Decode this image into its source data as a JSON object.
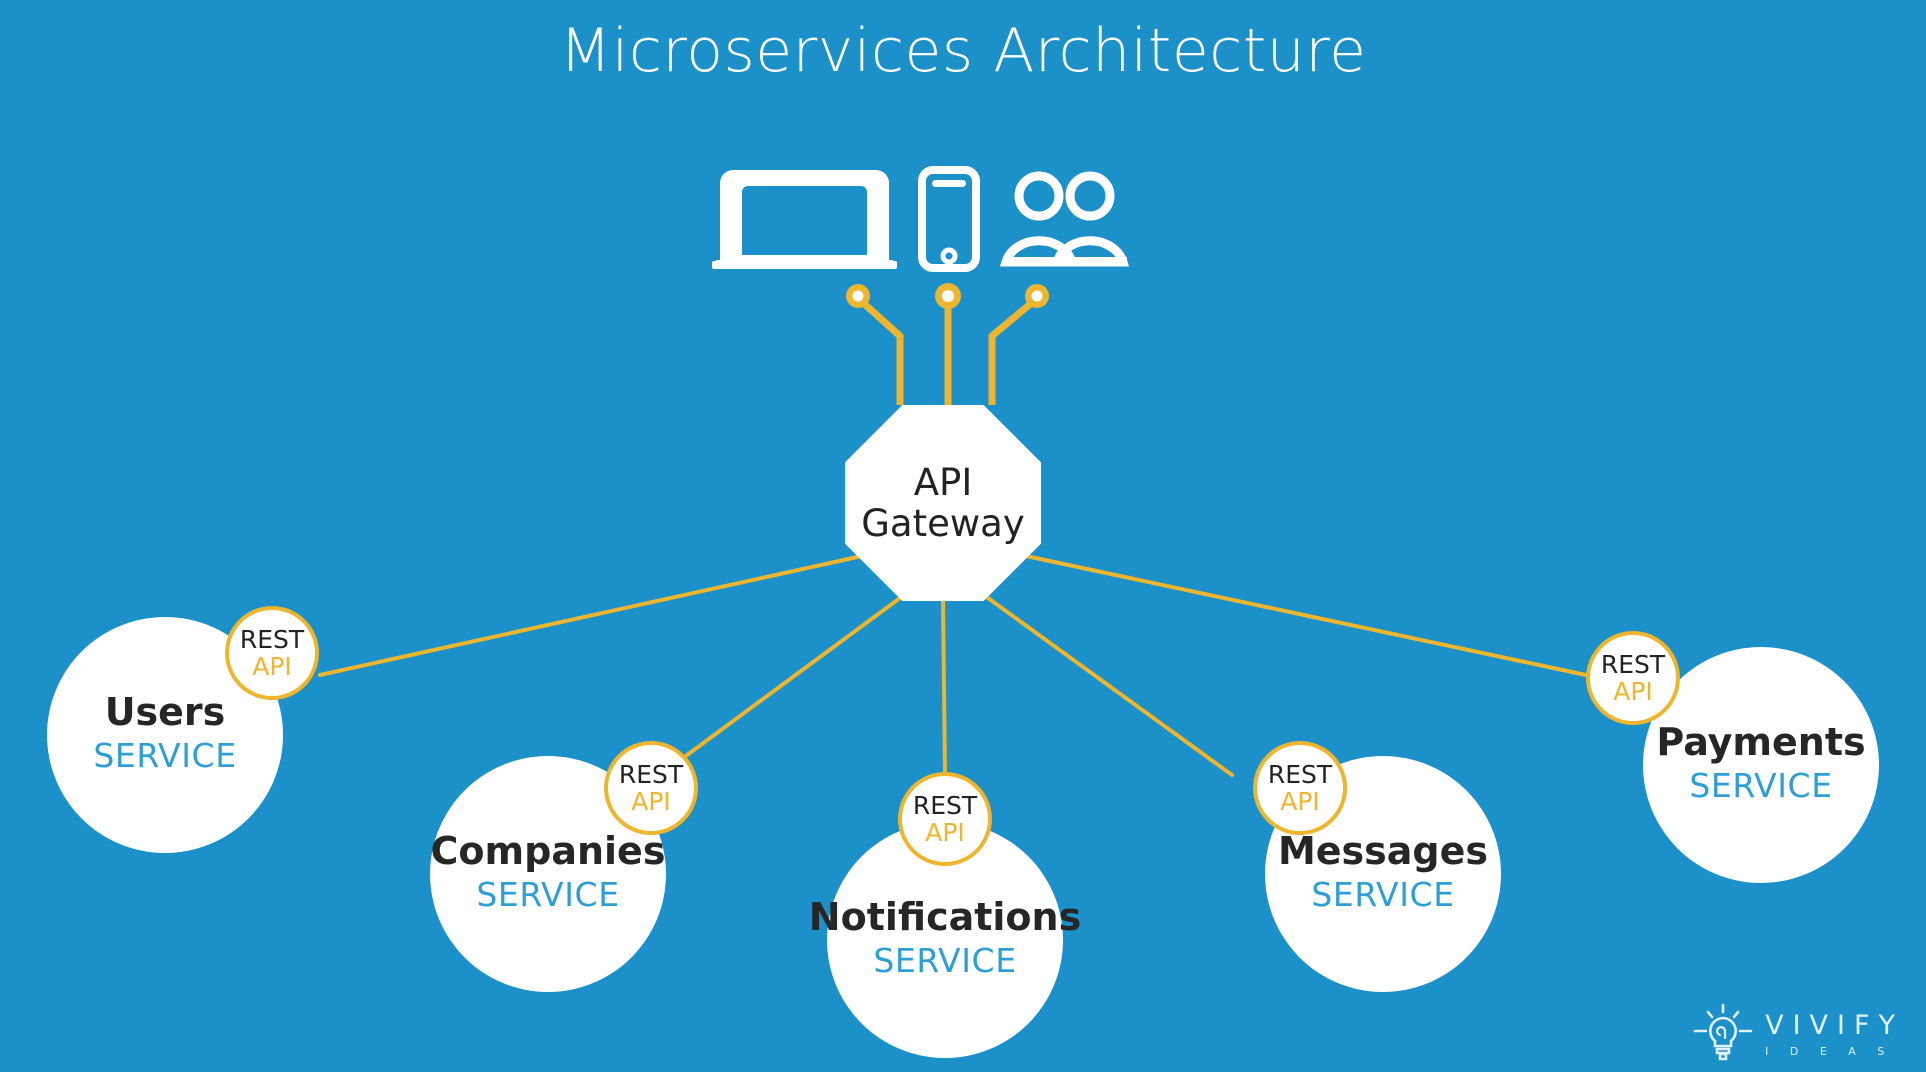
{
  "diagram": {
    "title": "Microservices Architecture",
    "background_color": "#1b90c9",
    "accent_color": "#eeb52f",
    "service_label_color": "#2e9fd6",
    "node_fill_color": "#ffffff"
  },
  "clients": {
    "icons": [
      {
        "name": "laptop-icon",
        "label": "Laptop"
      },
      {
        "name": "smartphone-icon",
        "label": "Smartphone"
      },
      {
        "name": "users-icon",
        "label": "Users"
      }
    ]
  },
  "gateway": {
    "name": "API Gateway",
    "line1": "API",
    "line2": "Gateway"
  },
  "badge": {
    "top": "REST",
    "bottom": "API"
  },
  "services": [
    {
      "name": "Users",
      "kind": "SERVICE"
    },
    {
      "name": "Companies",
      "kind": "SERVICE"
    },
    {
      "name": "Notifications",
      "kind": "SERVICE"
    },
    {
      "name": "Messages",
      "kind": "SERVICE"
    },
    {
      "name": "Payments",
      "kind": "SERVICE"
    }
  ],
  "logo": {
    "primary": "VIVIFY",
    "secondary": "I D E A S",
    "icon": "lightbulb-icon"
  }
}
